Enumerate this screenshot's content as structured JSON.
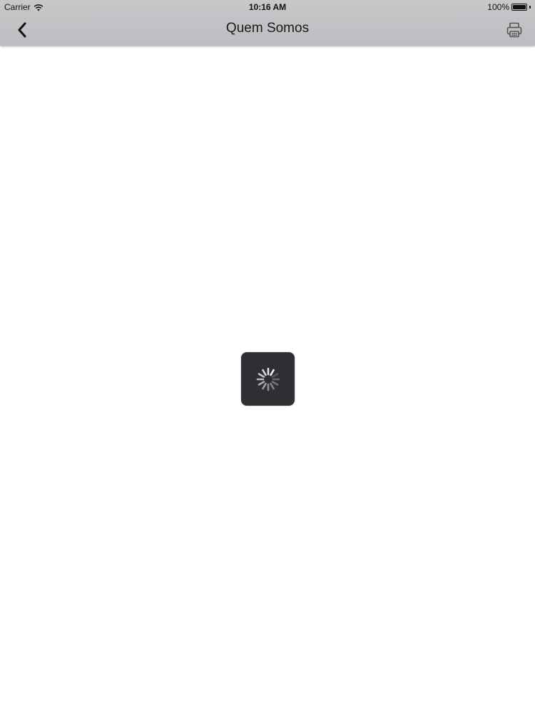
{
  "status_bar": {
    "carrier": "Carrier",
    "time": "10:16 AM",
    "battery": "100%",
    "battery_level": 1.0
  },
  "nav": {
    "title": "Quem Somos",
    "back_icon": "chevron-left-icon",
    "print_icon": "printer-icon"
  },
  "loading": {
    "spinner_icon": "activity-spinner-icon"
  },
  "colors": {
    "nav_background": "#c3c2c6",
    "page_background": "#ffffff",
    "hud_background": "#2f2e33"
  }
}
